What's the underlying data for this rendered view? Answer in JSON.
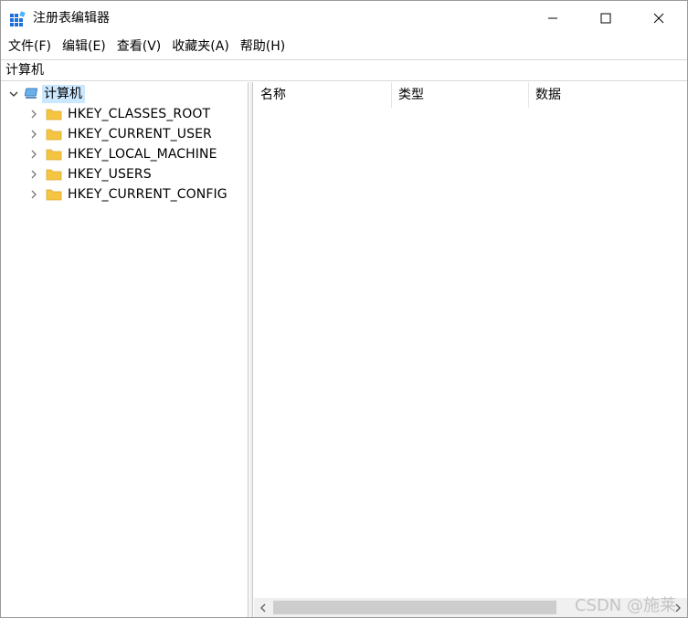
{
  "window": {
    "title": "注册表编辑器",
    "icon": "registry-editor-icon",
    "controls": [
      "minimize-icon",
      "maximize-icon",
      "close-icon"
    ]
  },
  "menu": {
    "items": [
      "文件(F)",
      "编辑(E)",
      "查看(V)",
      "收藏夹(A)",
      "帮助(H)"
    ]
  },
  "address": {
    "path": "计算机"
  },
  "tree": {
    "root_label": "计算机",
    "root_icon": "computer-icon",
    "hives": [
      "HKEY_CLASSES_ROOT",
      "HKEY_CURRENT_USER",
      "HKEY_LOCAL_MACHINE",
      "HKEY_USERS",
      "HKEY_CURRENT_CONFIG"
    ]
  },
  "list": {
    "columns": [
      "名称",
      "类型",
      "数据"
    ]
  },
  "watermark": "CSDN @施莱",
  "colors": {
    "selection": "#cce8ff",
    "folder": "#f5c542",
    "accent": "#0078d7"
  }
}
